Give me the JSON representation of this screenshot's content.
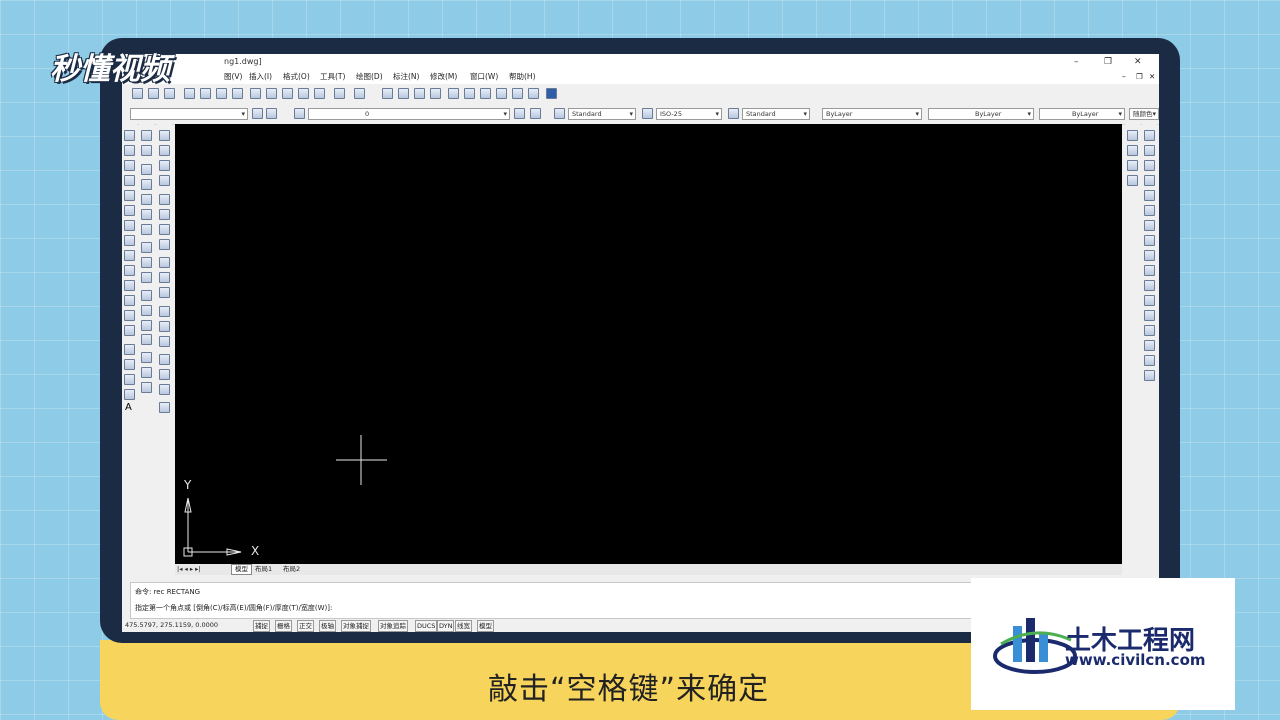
{
  "brand_top_left": "秒懂视频",
  "caption": "敲击“空格键”来确定",
  "app": {
    "title": "ng1.dwg]",
    "menus": [
      "图(V)",
      "插入(I)",
      "格式(O)",
      "工具(T)",
      "绘图(D)",
      "标注(N)",
      "修改(M)",
      "窗口(W)",
      "帮助(H)"
    ],
    "layer_value": "0",
    "text_style": "Standard",
    "dim_style": "ISO-25",
    "table_style": "Standard",
    "color": "ByLayer",
    "linetype": "ByLayer",
    "lineweight": "ByLayer",
    "plot_style": "随颜色",
    "tabs": [
      "模型",
      "布局1",
      "布局2"
    ],
    "command_line_1": "命令: rec RECTANG",
    "command_line_2": "指定第一个角点或 [倒角(C)/标高(E)/圆角(F)/厚度(T)/宽度(W)]:",
    "coordinates": "475.5797, 275.1159, 0.0000",
    "status_buttons": [
      "捕捉",
      "栅格",
      "正交",
      "极轴",
      "对象捕捉",
      "对象追踪",
      "DUCS",
      "DYN",
      "线宽",
      "模型"
    ],
    "ucs_x": "X",
    "ucs_y": "Y"
  },
  "watermark": {
    "name": "土木工程网",
    "url": "www.civilcn.com"
  },
  "colors": {
    "background": "#8ecbe6",
    "device": "#1b2b44",
    "band": "#f7d45b",
    "canvas": "#000000"
  }
}
